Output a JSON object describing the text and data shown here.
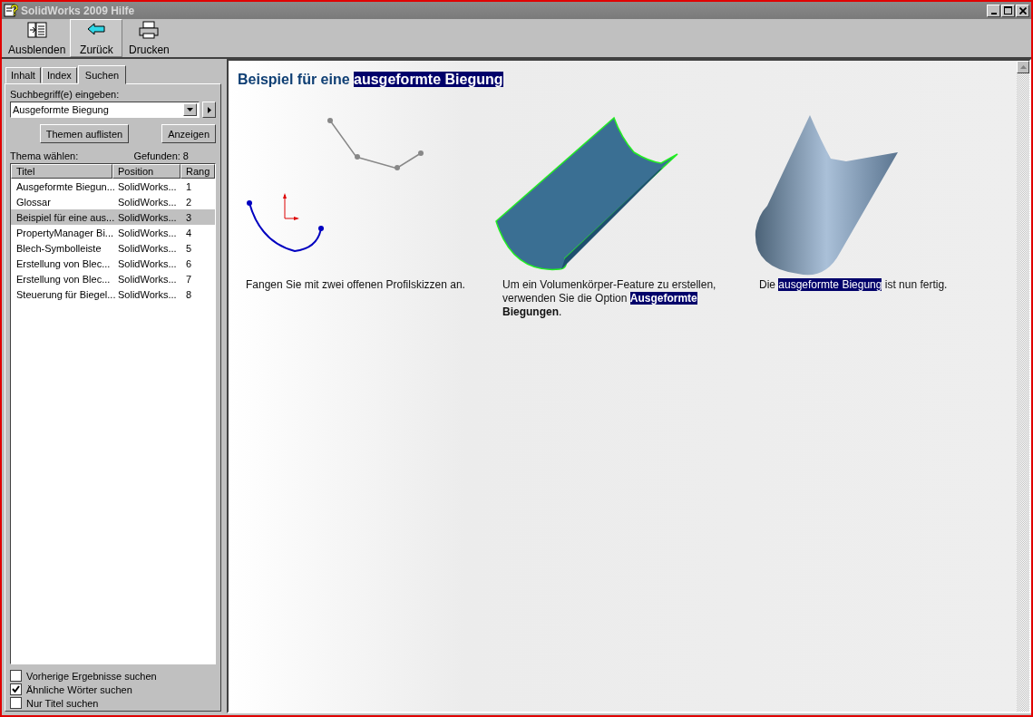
{
  "window": {
    "title": "SolidWorks 2009 Hilfe"
  },
  "toolbar": [
    {
      "label": "Ausblenden",
      "selected": false
    },
    {
      "label": "Zurück",
      "selected": true
    },
    {
      "label": "Drucken",
      "selected": false
    }
  ],
  "tabs": [
    {
      "label": "Inhalt",
      "selected": false
    },
    {
      "label": "Index",
      "selected": false
    },
    {
      "label": "Suchen",
      "selected": true
    }
  ],
  "search": {
    "label": "Suchbegriff(e) eingeben:",
    "value": "Ausgeformte Biegung"
  },
  "buttons": [
    "Themen auflisten",
    "Anzeigen"
  ],
  "topic_label": "Thema wählen:",
  "found": "Gefunden: 8",
  "table": {
    "columns": [
      "Titel",
      "Position",
      "Rang"
    ],
    "rows": [
      {
        "cells": [
          "Ausgeformte Biegun...",
          "SolidWorks...",
          "1"
        ],
        "selected": false
      },
      {
        "cells": [
          "Glossar",
          "SolidWorks...",
          "2"
        ],
        "selected": false
      },
      {
        "cells": [
          "Beispiel für eine aus...",
          "SolidWorks...",
          "3"
        ],
        "selected": true
      },
      {
        "cells": [
          "PropertyManager Bi...",
          "SolidWorks...",
          "4"
        ],
        "selected": false
      },
      {
        "cells": [
          "Blech-Symbolleiste",
          "SolidWorks...",
          "5"
        ],
        "selected": false
      },
      {
        "cells": [
          "Erstellung von Blec...",
          "SolidWorks...",
          "6"
        ],
        "selected": false
      },
      {
        "cells": [
          "Erstellung von Blec...",
          "SolidWorks...",
          "7"
        ],
        "selected": false
      },
      {
        "cells": [
          "Steuerung für Biegel...",
          "SolidWorks...",
          "8"
        ],
        "selected": false
      }
    ]
  },
  "checkboxes": [
    {
      "label": "Vorherige Ergebnisse suchen",
      "checked": false
    },
    {
      "label": "Ähnliche Wörter suchen",
      "checked": true
    },
    {
      "label": "Nur Titel suchen",
      "checked": false
    }
  ],
  "content": {
    "heading": [
      {
        "text": "Beispiel für eine ",
        "highlighted": false
      },
      {
        "text": "ausgeformte Biegung",
        "highlighted": true
      }
    ],
    "steps": [
      {
        "caption": [
          {
            "text": "Fangen Sie mit zwei offenen Profilskizzen an.",
            "highlighted": false,
            "bold": false
          }
        ]
      },
      {
        "caption": [
          {
            "text": "Um ein Volumenkörper-Feature zu erstellen, verwenden Sie die Option ",
            "highlighted": false,
            "bold": false
          },
          {
            "text": "Ausgeformte",
            "highlighted": true,
            "bold": true
          },
          {
            "text": " Biegungen",
            "highlighted": false,
            "bold": true
          },
          {
            "text": ".",
            "highlighted": false,
            "bold": false
          }
        ]
      },
      {
        "caption": [
          {
            "text": "Die ",
            "highlighted": false,
            "bold": false
          },
          {
            "text": "ausgeformte Biegung",
            "highlighted": true,
            "bold": false
          },
          {
            "text": " ist nun fertig.",
            "highlighted": false,
            "bold": false
          }
        ]
      }
    ]
  }
}
